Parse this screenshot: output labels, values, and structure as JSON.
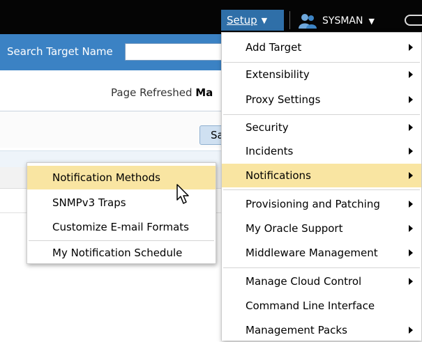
{
  "header": {
    "setup_label": "Setup",
    "user_label": "SYSMAN"
  },
  "search": {
    "label": "Search Target Name",
    "value": ""
  },
  "page": {
    "refresh_prefix": "Page Refreshed ",
    "refresh_value": "Ma",
    "save_button_partial": "Sa"
  },
  "setup_menu": {
    "items": [
      {
        "label": "Add Target",
        "submenu": true
      },
      {
        "label": "Extensibility",
        "submenu": true
      },
      {
        "label": "Proxy Settings",
        "submenu": true
      },
      {
        "label": "Security",
        "submenu": true
      },
      {
        "label": "Incidents",
        "submenu": true
      },
      {
        "label": "Notifications",
        "submenu": true,
        "highlighted": true
      },
      {
        "label": "Provisioning and Patching",
        "submenu": true
      },
      {
        "label": "My Oracle Support",
        "submenu": true
      },
      {
        "label": "Middleware Management",
        "submenu": true
      },
      {
        "label": "Manage Cloud Control",
        "submenu": true
      },
      {
        "label": "Command Line Interface",
        "submenu": false
      },
      {
        "label": "Management Packs",
        "submenu": true
      }
    ]
  },
  "notifications_submenu": {
    "items": [
      {
        "label": "Notification Methods",
        "highlighted": true
      },
      {
        "label": "SNMPv3 Traps"
      },
      {
        "label": "Customize E-mail Formats"
      },
      {
        "label": "My Notification Schedule"
      }
    ]
  },
  "colors": {
    "topbar": "#050505",
    "setup_active": "#2f6fa8",
    "searchbar": "#3b82c4",
    "menu_highlight": "#f9e5a2"
  }
}
